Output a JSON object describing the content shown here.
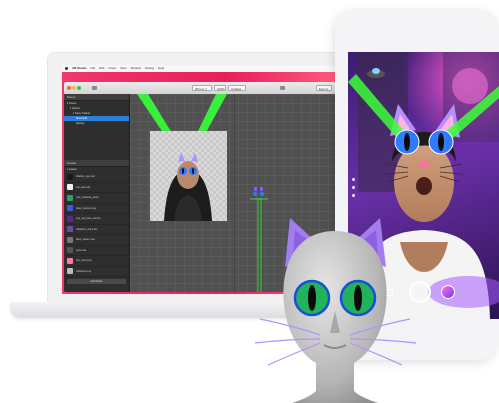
{
  "laptop": {
    "menubar": {
      "app_name": "AR Studio",
      "items": [
        "File",
        "Edit",
        "Insert",
        "View",
        "Window",
        "Debug",
        "Help"
      ]
    },
    "toolbar": {
      "device_selector": "iPhone 7",
      "zoom_label": "100%",
      "project_name": "Untitled",
      "export_label": "Export"
    },
    "scene_panel": {
      "header": "Scene",
      "items": [
        {
          "label": "▾ Scene"
        },
        {
          "label": "▾ Device"
        },
        {
          "label": "▾ Face Tracker"
        },
        {
          "label": "  facemesh",
          "selected": true
        },
        {
          "label": "  lighting"
        }
      ]
    },
    "assets_panel": {
      "header": "Assets",
      "items": [
        {
          "label": "▾ Assets"
        },
        {
          "label": "shader_eye.mat",
          "color": "#1a1a1a"
        },
        {
          "label": "cat_ears.obj",
          "color": "#f2f2f2"
        },
        {
          "label": "eye_material_green",
          "color": "#29a36a"
        },
        {
          "label": "laser_texture.png",
          "color": "#3b5bdc"
        },
        {
          "label": "eye_cat_blue_texture",
          "color": "#5a2a8a"
        },
        {
          "label": "whiskers_anim.fbx",
          "color": "#6b4aa0"
        },
        {
          "label": "laser_beam.mat",
          "color": "#777777"
        },
        {
          "label": "ears.mat",
          "color": "#555555"
        },
        {
          "label": "cat_nose.png",
          "color": "#ff78a0"
        },
        {
          "label": "whiskers.png",
          "color": "#bbbbbb"
        }
      ],
      "add_label": "Add Asset"
    },
    "colors": {
      "screen_bg": "#e8245d",
      "selection": "#2a7fd6",
      "laser": "#37ff3a"
    }
  },
  "phone": {
    "colors": {
      "aurora_pink": "#ff5bd0",
      "cosmic_purple": "#6a2fa8",
      "laser": "#3bff37"
    }
  },
  "head_model": {
    "colors": {
      "skin": "#c9c9c9",
      "ears": "#b48fff",
      "eyes": "#22b35a",
      "whiskers": "#b48fff"
    }
  }
}
